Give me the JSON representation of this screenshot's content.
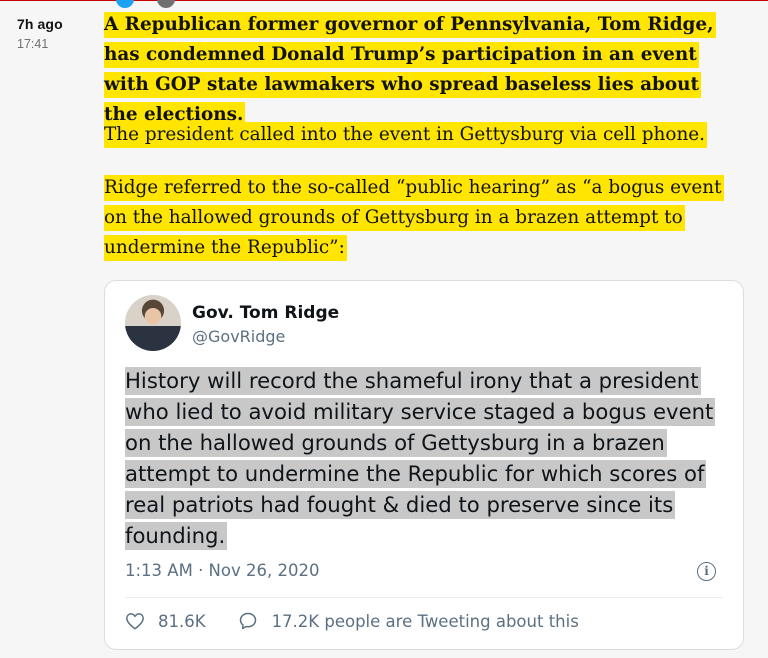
{
  "meta": {
    "ago": "7h ago",
    "time": "17:41"
  },
  "post": {
    "para1": "A Republican former governor of Pennsylvania, Tom Ridge, has condemned Donald Trump’s participation in an event with GOP state lawmakers who spread baseless lies about the elections.",
    "para2": "The president called into the event in Gettysburg via cell phone.",
    "para3": "Ridge referred to the so-called “public hearing” as “a bogus event on the hallowed grounds of Gettysburg in a brazen attempt to undermine the Republic”:"
  },
  "tweet": {
    "name": "Gov. Tom Ridge",
    "handle": "@GovRidge",
    "text": "History will record the shameful irony that a president who lied to avoid military service staged a bogus event on the hallowed grounds of Gettysburg in a brazen attempt to undermine the Republic for which scores of real patriots had fought & died to preserve since its founding.",
    "date": "1:13 AM · Nov 26, 2020",
    "likes": "81.6K",
    "talking": "17.2K people are Tweeting about this",
    "info_glyph": "i"
  },
  "colors": {
    "highlight": "#ffe500",
    "tweet_highlight": "#c8c8c8",
    "accent_line": "#c70000",
    "twitter_blue": "#1da1f2"
  },
  "icons": {
    "like": "heart-outline-icon",
    "reply": "speech-bubble-icon",
    "info": "info-icon"
  }
}
